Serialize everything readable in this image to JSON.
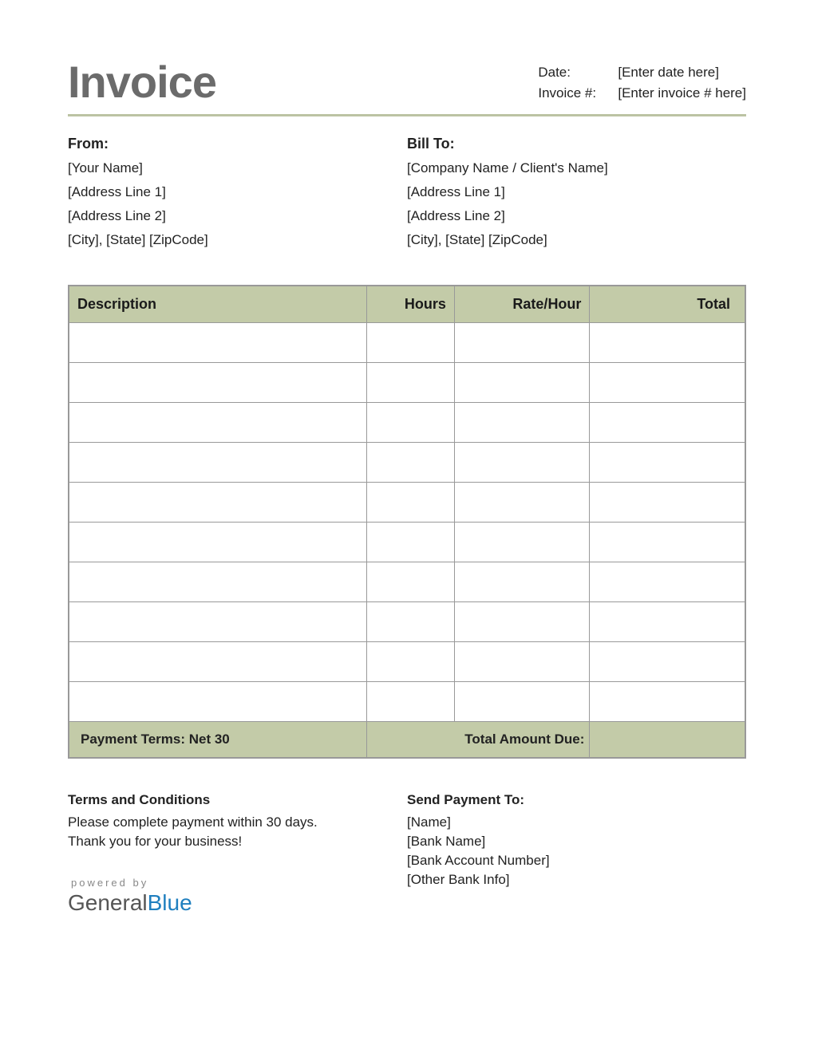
{
  "title": "Invoice",
  "meta": {
    "date_label": "Date:",
    "date_value": "[Enter date here]",
    "invno_label": "Invoice #:",
    "invno_value": "[Enter invoice # here]"
  },
  "from": {
    "heading": "From:",
    "name": "[Your Name]",
    "addr1": "[Address Line 1]",
    "addr2": "[Address Line 2]",
    "city": "[City], [State] [ZipCode]"
  },
  "billto": {
    "heading": "Bill To:",
    "name": "[Company Name / Client's Name]",
    "addr1": "[Address Line 1]",
    "addr2": "[Address Line 2]",
    "city": "[City], [State] [ZipCode]"
  },
  "table": {
    "headers": {
      "description": "Description",
      "hours": "Hours",
      "rate": "Rate/Hour",
      "total": "Total"
    },
    "rows": [
      {
        "description": "",
        "hours": "",
        "rate": "",
        "total": ""
      },
      {
        "description": "",
        "hours": "",
        "rate": "",
        "total": ""
      },
      {
        "description": "",
        "hours": "",
        "rate": "",
        "total": ""
      },
      {
        "description": "",
        "hours": "",
        "rate": "",
        "total": ""
      },
      {
        "description": "",
        "hours": "",
        "rate": "",
        "total": ""
      },
      {
        "description": "",
        "hours": "",
        "rate": "",
        "total": ""
      },
      {
        "description": "",
        "hours": "",
        "rate": "",
        "total": ""
      },
      {
        "description": "",
        "hours": "",
        "rate": "",
        "total": ""
      },
      {
        "description": "",
        "hours": "",
        "rate": "",
        "total": ""
      },
      {
        "description": "",
        "hours": "",
        "rate": "",
        "total": ""
      }
    ],
    "footer": {
      "payment_terms": "Payment Terms: Net 30",
      "total_due_label": "Total Amount Due:",
      "total_due_value": ""
    }
  },
  "terms": {
    "heading": "Terms and Conditions",
    "line1": "Please complete payment within 30 days.",
    "line2": "Thank you for your business!"
  },
  "payto": {
    "heading": "Send Payment To:",
    "name": "[Name]",
    "bank": "[Bank Name]",
    "account": "[Bank Account Number]",
    "other": "[Other Bank Info]"
  },
  "branding": {
    "powered": "powered by",
    "name_part1": "General",
    "name_part2": "Blue"
  }
}
